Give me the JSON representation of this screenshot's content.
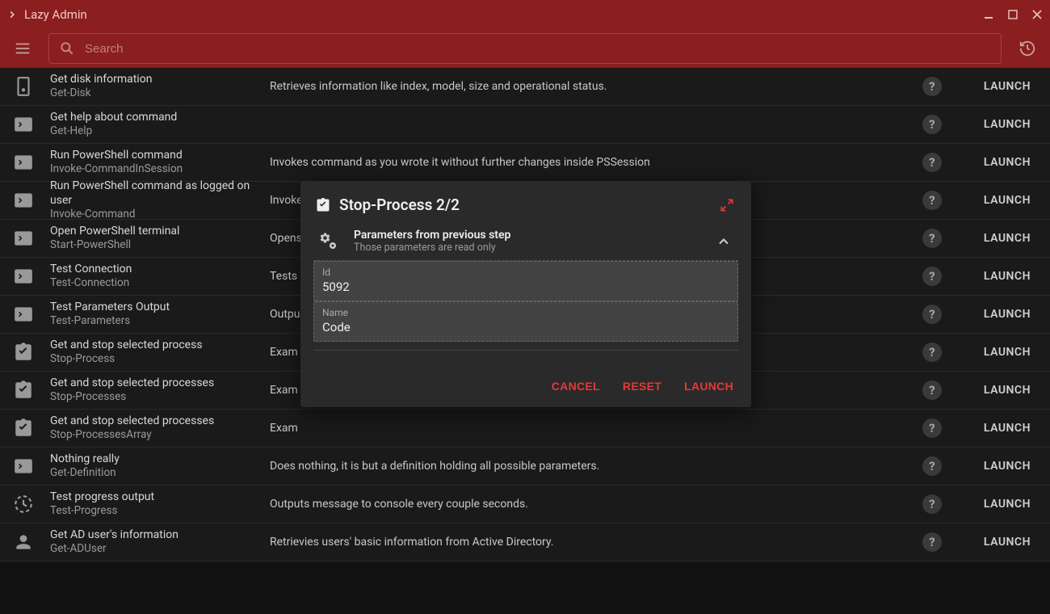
{
  "app": {
    "title": "Lazy Admin"
  },
  "search": {
    "placeholder": "Search"
  },
  "list": [
    {
      "icon": "disk",
      "title": "Get disk information",
      "sub": "Get-Disk",
      "desc": "Retrieves information like index, model, size and operational status."
    },
    {
      "icon": "terminal",
      "title": "Get help about command",
      "sub": "Get-Help",
      "desc": ""
    },
    {
      "icon": "terminal",
      "title": "Run PowerShell command",
      "sub": "Invoke-CommandInSession",
      "desc": "Invokes command as you wrote it without further changes inside PSSession"
    },
    {
      "icon": "terminal",
      "title": "Run PowerShell command as logged on user",
      "sub": "Invoke-Command",
      "desc": "Invoke"
    },
    {
      "icon": "terminal",
      "title": "Open PowerShell terminal",
      "sub": "Start-PowerShell",
      "desc": "Opens"
    },
    {
      "icon": "terminal",
      "title": "Test Connection",
      "sub": "Test-Connection",
      "desc": "Tests"
    },
    {
      "icon": "terminal",
      "title": "Test Parameters Output",
      "sub": "Test-Parameters",
      "desc": "Outpu"
    },
    {
      "icon": "task",
      "title": "Get and stop selected process",
      "sub": "Stop-Process",
      "desc": "Exam"
    },
    {
      "icon": "task",
      "title": "Get and stop selected processes",
      "sub": "Stop-Processes",
      "desc": "Exam"
    },
    {
      "icon": "task",
      "title": "Get and stop selected processes",
      "sub": "Stop-ProcessesArray",
      "desc": "Exam"
    },
    {
      "icon": "terminal",
      "title": "Nothing really",
      "sub": "Get-Definition",
      "desc": "Does nothing, it is but a definition holding all possible parameters."
    },
    {
      "icon": "progress",
      "title": "Test progress output",
      "sub": "Test-Progress",
      "desc": "Outputs message to console every couple seconds."
    },
    {
      "icon": "user",
      "title": "Get AD user's information",
      "sub": "Get-ADUser",
      "desc": "Retrievies users' basic information from Active Directory."
    }
  ],
  "row_actions": {
    "launch": "LAUNCH"
  },
  "dialog": {
    "title": "Stop-Process 2/2",
    "section_title": "Parameters from previous step",
    "section_sub": "Those parameters are read only",
    "fields": [
      {
        "label": "Id",
        "value": "5092"
      },
      {
        "label": "Name",
        "value": "Code"
      }
    ],
    "actions": {
      "cancel": "CANCEL",
      "reset": "RESET",
      "launch": "LAUNCH"
    }
  }
}
